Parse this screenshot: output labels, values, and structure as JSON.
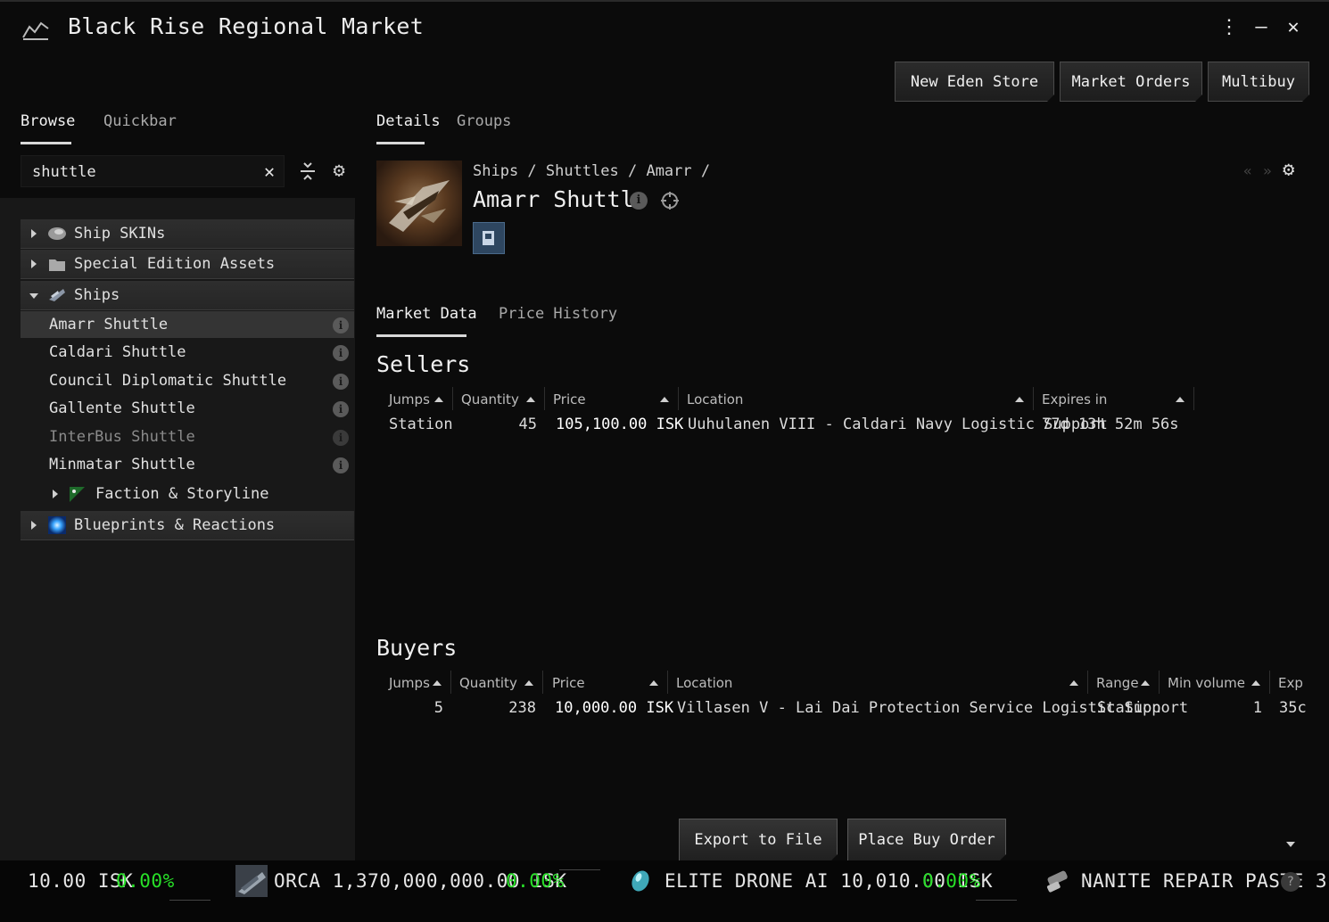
{
  "window": {
    "title": "Black Rise Regional Market"
  },
  "title_controls": {
    "menu": "⋮",
    "minimize": "—",
    "close": "✕"
  },
  "top_buttons": {
    "store": "New Eden Store",
    "orders": "Market Orders",
    "multibuy": "Multibuy"
  },
  "left": {
    "tabs": [
      "Browse",
      "Quickbar"
    ],
    "search": {
      "value": "shuttle",
      "placeholder": ""
    },
    "tree": [
      {
        "label": "Ship SKINs",
        "icon": "ship-skin-icon"
      },
      {
        "label": "Special Edition Assets",
        "icon": "folder-icon"
      },
      {
        "label": "Ships",
        "icon": "ships-icon"
      },
      {
        "label": "Amarr Shuttle"
      },
      {
        "label": "Caldari Shuttle"
      },
      {
        "label": "Council Diplomatic Shuttle"
      },
      {
        "label": "Gallente Shuttle"
      },
      {
        "label": "InterBus Shuttle"
      },
      {
        "label": "Minmatar Shuttle"
      },
      {
        "label": "Faction & Storyline",
        "icon": "faction-flag-icon"
      },
      {
        "label": "Blueprints & Reactions",
        "icon": "blueprint-orb-icon"
      }
    ]
  },
  "right": {
    "tabs": [
      "Details",
      "Groups"
    ],
    "breadcrumb": "Ships / Shuttles / Amarr /",
    "item_name": "Amarr Shuttle",
    "market_tabs": [
      "Market Data",
      "Price History"
    ],
    "sellers": {
      "title": "Sellers",
      "columns": [
        "Jumps",
        "Quantity",
        "Price",
        "Location",
        "Expires in"
      ],
      "rows": [
        {
          "jumps": "Station",
          "quantity": "45",
          "price": "105,100.00 ISK",
          "location": "Uuhulanen VIII - Caldari Navy Logistic Support",
          "expires": "77d 13h 52m 56s"
        }
      ]
    },
    "buyers": {
      "title": "Buyers",
      "columns": [
        "Jumps",
        "Quantity",
        "Price",
        "Location",
        "Range",
        "Min volume",
        "Exp"
      ],
      "rows": [
        {
          "jumps": "5",
          "quantity": "238",
          "price": "10,000.00 ISK",
          "location": "Villasen V - Lai Dai Protection Service Logistic Support",
          "range": "Station",
          "min_volume": "1",
          "expires": "35c"
        }
      ]
    },
    "actions": {
      "export": "Export to File",
      "buy": "Place Buy Order"
    }
  },
  "ticker": {
    "items": [
      {
        "text": "10.00 ISK",
        "change": "0.00%"
      },
      {
        "text": "ORCA 1,370,000,000.00 ISK",
        "change": "0.00%",
        "icon": "orca-ship-icon"
      },
      {
        "text": "ELITE DRONE AI 10,010.00 ISK",
        "change": "0.00%",
        "icon": "drone-ai-icon"
      },
      {
        "text": "NANITE REPAIR PASTE 3",
        "icon": "nanite-paste-icon"
      }
    ]
  },
  "colors": {
    "positive": "#28e028",
    "background": "#0b0b0b",
    "panel": "#181818"
  }
}
